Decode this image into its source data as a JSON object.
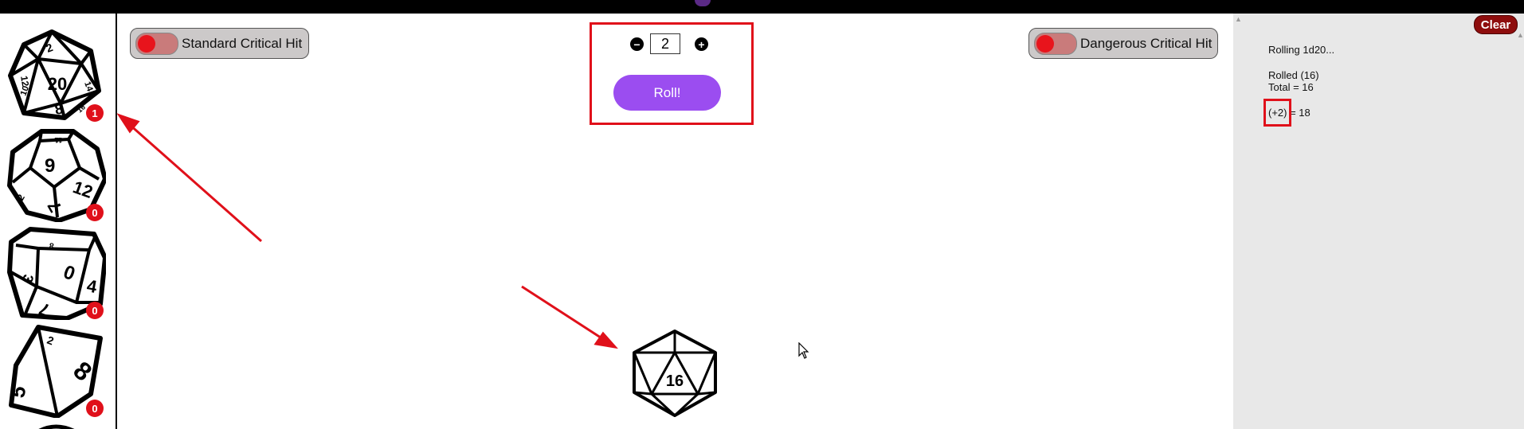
{
  "app": {
    "accent_color": "#9b4df0",
    "alert_color": "#e0101a"
  },
  "sidebar": {
    "dice": [
      {
        "name": "d20",
        "count": "1",
        "faces": [
          "2",
          "20",
          "14",
          "12",
          "10",
          "8",
          "16"
        ]
      },
      {
        "name": "d12",
        "count": "0",
        "faces": [
          "9",
          "12",
          "11",
          "7",
          "2"
        ]
      },
      {
        "name": "d10",
        "count": "0",
        "faces": [
          "0",
          "8",
          "4",
          "3",
          "7"
        ]
      },
      {
        "name": "d8",
        "count": "0",
        "faces": [
          "8",
          "2",
          "5"
        ]
      }
    ]
  },
  "controls": {
    "standard_crit_label": "Standard Critical Hit",
    "dangerous_crit_label": "Dangerous Critical Hit",
    "dice_count": "2",
    "minus_icon": "−",
    "plus_icon": "+",
    "roll_label": "Roll!"
  },
  "log": {
    "clear_label": "Clear",
    "lines": [
      "Rolling 1d20...",
      "Rolled (16)",
      "Total = 16",
      "(+2) = 18"
    ]
  },
  "result": {
    "value": "16"
  }
}
